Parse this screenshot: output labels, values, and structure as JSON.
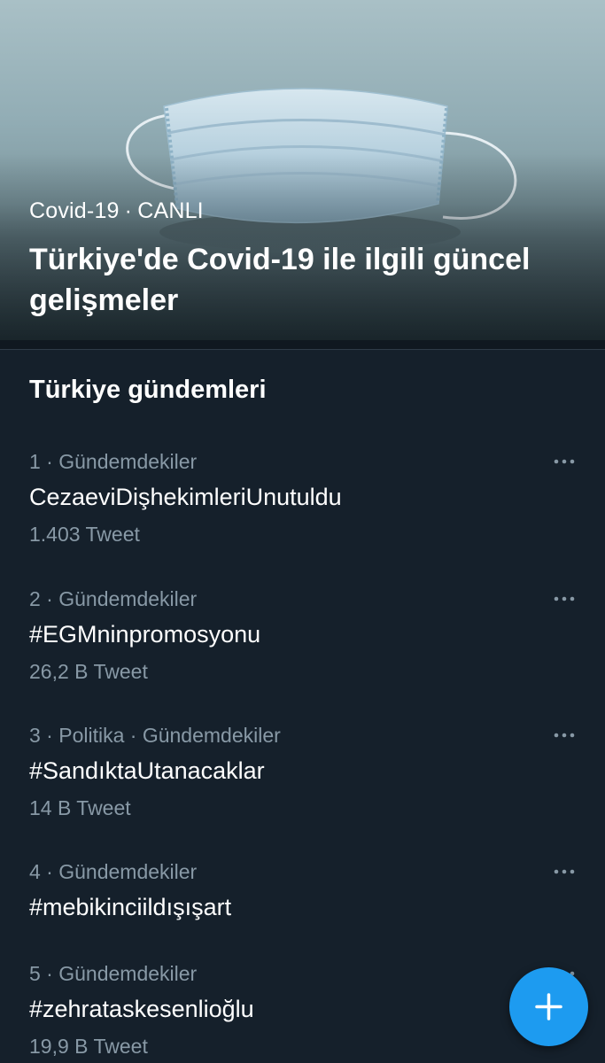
{
  "hero": {
    "category": "Covid-19",
    "separator": "·",
    "status": "CANLI",
    "title": "Türkiye'de Covid-19 ile ilgili güncel gelişmeler",
    "image_icon": "face-mask-photo"
  },
  "trends_section": {
    "title": "Türkiye gündemleri"
  },
  "trends": [
    {
      "meta": "1 · Gündemdekiler",
      "name": "CezaeviDişhekimleriUnutuldu",
      "count": "1.403 Tweet"
    },
    {
      "meta": "2 · Gündemdekiler",
      "name": "#EGMninpromosyonu",
      "count": "26,2 B Tweet"
    },
    {
      "meta": "3 · Politika · Gündemdekiler",
      "name": "#SandıktaUtanacaklar",
      "count": "14 B Tweet"
    },
    {
      "meta": "4 · Gündemdekiler",
      "name": "#mebikinciildışışart",
      "count": ""
    },
    {
      "meta": "5 · Gündemdekiler",
      "name": "#zehrataskesenlioğlu",
      "count": "19,9 B Tweet"
    }
  ],
  "icons": {
    "more": "more-horizontal-icon",
    "compose": "plus-icon"
  },
  "colors": {
    "background": "#15202b",
    "secondary_text": "#8899a6",
    "accent": "#1d9bf0",
    "primary_text": "#ffffff"
  }
}
